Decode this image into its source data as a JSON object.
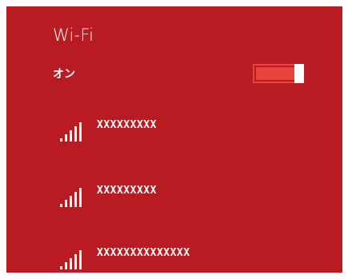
{
  "panel": {
    "background": "#b81c22",
    "title": "Wi-Fi",
    "toggle": {
      "label": "オン",
      "state": "on",
      "accent": "#e8463d"
    },
    "networks": [
      {
        "ssid": "XXXXXXXXX",
        "signal": "full",
        "icon": "wifi-signal-bars-icon"
      },
      {
        "ssid": "XXXXXXXXX",
        "signal": "full",
        "icon": "wifi-signal-bars-icon"
      },
      {
        "ssid": "XXXXXXXXXXXXXX",
        "signal": "full",
        "icon": "wifi-signal-bars-icon"
      }
    ]
  }
}
